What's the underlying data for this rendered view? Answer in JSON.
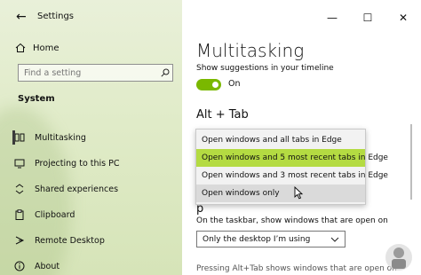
{
  "window": {
    "app_title": "Settings",
    "back_glyph": "←"
  },
  "sidebar": {
    "home_label": "Home",
    "search_placeholder": "Find a setting",
    "section_label": "System",
    "items": [
      {
        "label": "Multitasking",
        "icon": "multitasking-icon",
        "active": true
      },
      {
        "label": "Projecting to this PC",
        "icon": "projecting-icon"
      },
      {
        "label": "Shared experiences",
        "icon": "shared-experiences-icon"
      },
      {
        "label": "Clipboard",
        "icon": "clipboard-icon"
      },
      {
        "label": "Remote Desktop",
        "icon": "remote-desktop-icon"
      },
      {
        "label": "About",
        "icon": "about-icon"
      }
    ]
  },
  "window_controls": {
    "minimize": "—",
    "maximize": "☐",
    "close": "✕"
  },
  "main": {
    "title": "Multitasking",
    "timeline_label": "Show suggestions in your timeline",
    "toggle_state": "On",
    "accent_color": "#7ab800",
    "alt_tab_heading": "Alt + Tab",
    "dropdown_options": [
      "Open windows and all tabs in Edge",
      "Open windows and 5 most recent tabs in Edge",
      "Open windows and 3 most recent tabs in Edge",
      "Open windows only"
    ],
    "selected_option_index": 1,
    "hovered_option_index": 3,
    "hidden_heading_fragment": "p",
    "taskbar_label": "On the taskbar, show windows that are open on",
    "taskbar_value": "Only the desktop I’m using",
    "alt_tab_text": "Pressing Alt+Tab shows windows that are open on"
  }
}
